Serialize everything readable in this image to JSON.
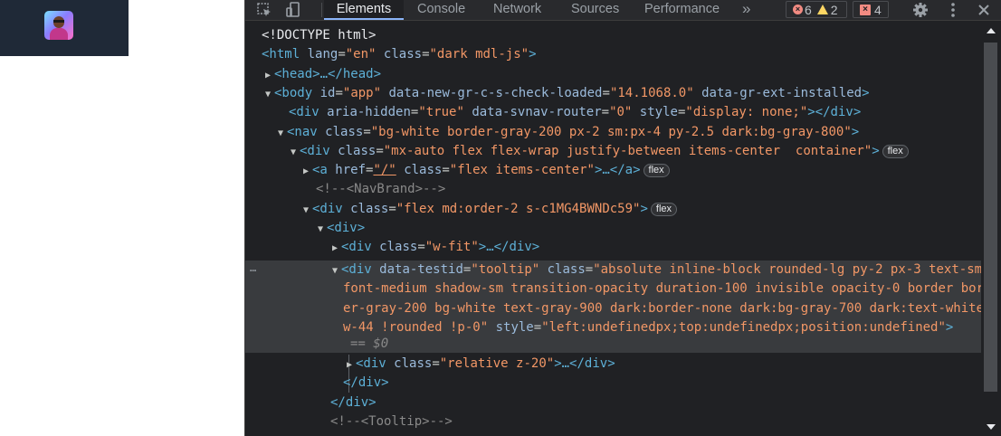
{
  "page": {
    "avatar_alt": "avatar"
  },
  "toolbar": {
    "tabs": [
      {
        "label": "Elements",
        "active": true
      },
      {
        "label": "Console"
      },
      {
        "label": "Network"
      },
      {
        "label": "Sources"
      },
      {
        "label": "Performance"
      }
    ],
    "more_tabs": "»",
    "errors": "6",
    "warnings": "2",
    "issues": "4",
    "icons": [
      "inspect-element-icon",
      "device-toolbar-icon",
      "settings-gear-icon",
      "kebab-menu-icon",
      "close-icon"
    ]
  },
  "code": {
    "l1": "<!DOCTYPE html>",
    "l2_tag_open": "<html",
    "l2_a1": "lang",
    "l2_v1": "\"en\"",
    "l2_a2": "class",
    "l2_v2": "\"dark mdl-js\"",
    "l2_close": ">",
    "l3": "<head>…</head>",
    "l4_tag": "<body",
    "l4_a1": "id",
    "l4_v1": "\"app\"",
    "l4_a2": "data-new-gr-c-s-check-loaded",
    "l4_v2": "\"14.1068.0\"",
    "l4_a3": "data-gr-ext-installed",
    "l4_close": ">",
    "l5_tag": "<div",
    "l5_a1": "aria-hidden",
    "l5_v1": "\"true\"",
    "l5_a2": "data-svnav-router",
    "l5_v2": "\"0\"",
    "l5_a3": "style",
    "l5_v3": "\"display: none;\"",
    "l5_close": "></div>",
    "l6_tag": "<nav",
    "l6_a1": "class",
    "l6_v1": "\"bg-white border-gray-200 px-2 sm:px-4 py-2.5 dark:bg-gray-800\"",
    "l6_close": ">",
    "l7_tag": "<div",
    "l7_a1": "class",
    "l7_v1": "\"mx-auto flex flex-wrap justify-between items-center  container\"",
    "l7_close": ">",
    "l7_pill": "flex",
    "l8_tag": "<a",
    "l8_a1": "href",
    "l8_v1": "\"/\"",
    "l8_a2": "class",
    "l8_v2": "\"flex items-center\"",
    "l8_close": ">…</a>",
    "l8_pill": "flex",
    "l9": "<!--<NavBrand>-->",
    "l10_tag": "<div",
    "l10_a1": "class",
    "l10_v1": "\"flex md:order-2 s-c1MG4BWNDc59\"",
    "l10_close": ">",
    "l10_pill": "flex",
    "l11": "<div>",
    "l12_tag": "<div",
    "l12_a1": "class",
    "l12_v1": "\"w-fit\"",
    "l12_close": ">…</div>",
    "l13_tag": "<div",
    "l13_a1": "data-testid",
    "l13_v1": "\"tooltip\"",
    "l13_a2": "class",
    "l13_v2a": "\"absolute inline-block rounded-lg py-2 px-3 text-sm",
    "l14": "font-medium shadow-sm transition-opacity duration-100 invisible opacity-0 border bord",
    "l15": "er-gray-200 bg-white text-gray-900 dark:border-none dark:bg-gray-700 dark:text-white",
    "l16_v": "w-44 !rounded !p-0\"",
    "l16_a": "style",
    "l16_v2": "\"left:undefinedpx;top:undefinedpx;position:undefined\"",
    "l16_close": ">",
    "l17": "== $0",
    "l18_tag": "<div",
    "l18_a1": "class",
    "l18_v1": "\"relative z-20\"",
    "l18_close": ">…</div>",
    "l19": "</div>",
    "l20": "</div>",
    "l21": "<!--<Tooltip>-->",
    "dots": "…"
  }
}
